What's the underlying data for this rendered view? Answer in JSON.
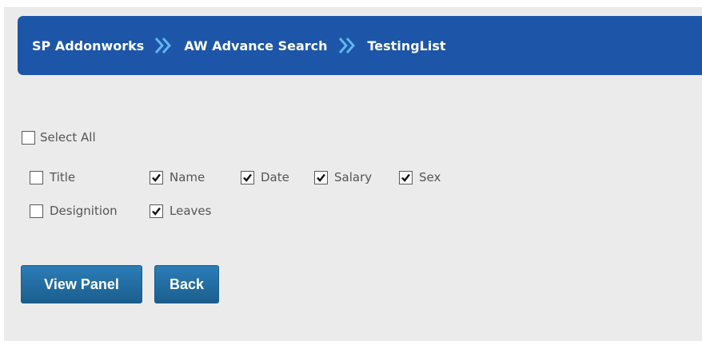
{
  "breadcrumb": {
    "items": [
      {
        "label": "SP Addonworks"
      },
      {
        "label": "AW Advance Search"
      },
      {
        "label": "TestingList"
      }
    ],
    "separator_icon": "double-chevron-right-icon",
    "background_color": "#1d56a8",
    "separator_color": "#5fb6f0"
  },
  "select_all": {
    "label": "Select All",
    "checked": false
  },
  "columns": [
    {
      "label": "Title",
      "checked": false
    },
    {
      "label": "Name",
      "checked": true
    },
    {
      "label": "Date",
      "checked": true
    },
    {
      "label": "Salary",
      "checked": true
    },
    {
      "label": "Sex",
      "checked": true
    },
    {
      "label": "Designition",
      "checked": false
    },
    {
      "label": "Leaves",
      "checked": true
    }
  ],
  "buttons": {
    "view_panel": "View Panel",
    "back": "Back"
  }
}
